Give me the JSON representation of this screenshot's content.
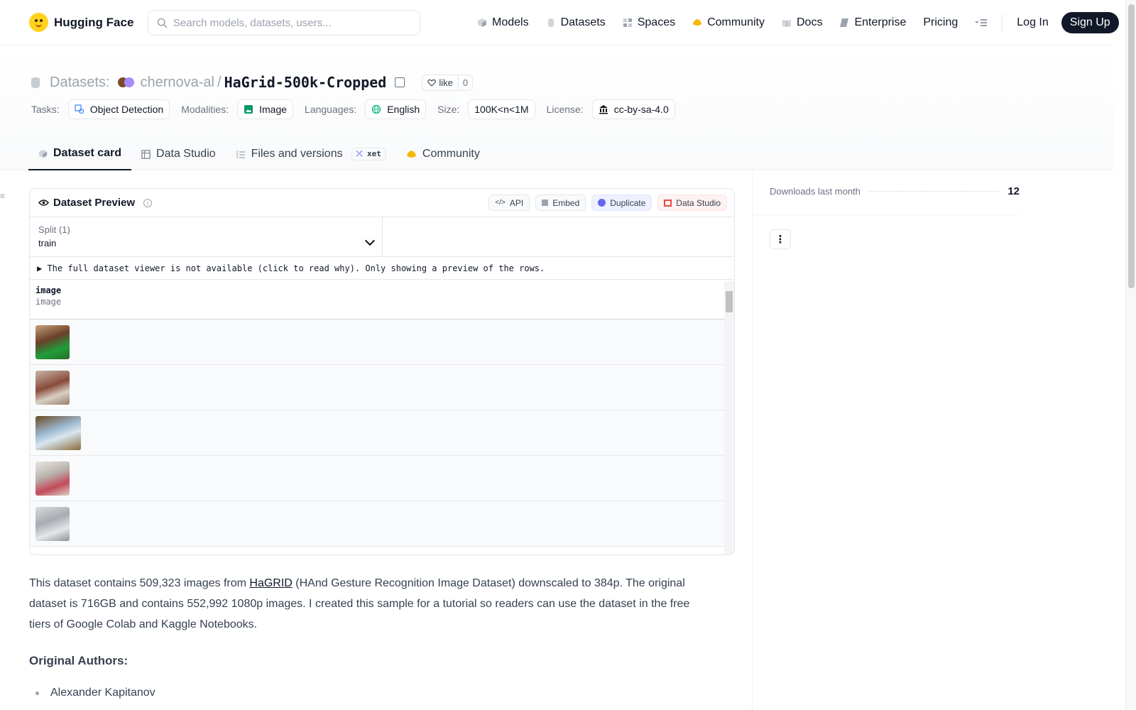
{
  "nav": {
    "brand": "Hugging Face",
    "search_placeholder": "Search models, datasets, users...",
    "links": [
      "Models",
      "Datasets",
      "Spaces",
      "Community",
      "Docs",
      "Enterprise",
      "Pricing"
    ],
    "login": "Log In",
    "signup": "Sign Up"
  },
  "header": {
    "section": "Datasets:",
    "owner": "chernova-al",
    "separator": "/",
    "name": "HaGrid-500k-Cropped",
    "like_label": "like",
    "like_count": "0"
  },
  "tags": {
    "tasks_label": "Tasks:",
    "task": "Object Detection",
    "modalities_label": "Modalities:",
    "modality": "Image",
    "languages_label": "Languages:",
    "language": "English",
    "size_label": "Size:",
    "size": "100K<n<1M",
    "license_label": "License:",
    "license": "cc-by-sa-4.0"
  },
  "tabs": {
    "card": "Dataset card",
    "studio": "Data Studio",
    "files": "Files and versions",
    "xet": "xet",
    "community": "Community"
  },
  "preview": {
    "title": "Dataset Preview",
    "api": "API",
    "embed": "Embed",
    "duplicate": "Duplicate",
    "data_studio": "Data Studio",
    "split_label": "Split (1)",
    "split_value": "train",
    "notice": "▶ The full dataset viewer is not available (click to read why). Only showing a preview of the rows.",
    "column_name": "image",
    "column_type": "image"
  },
  "description": {
    "pre": "This dataset contains 509,323 images from ",
    "link": "HaGRID",
    "post": " (HAnd Gesture Recognition Image Dataset) downscaled to 384p. The original dataset is 716GB and contains 552,992 1080p images. I created this sample for a tutorial so readers can use the dataset in the free tiers of Google Colab and Kaggle Notebooks."
  },
  "authors": {
    "heading": "Original Authors:",
    "first": "Alexander Kapitanov"
  },
  "sidebar": {
    "downloads_label": "Downloads last month",
    "downloads_value": "12"
  },
  "colors": {
    "accent_dark": "#111827",
    "brand_yellow": "#ffd21e"
  }
}
